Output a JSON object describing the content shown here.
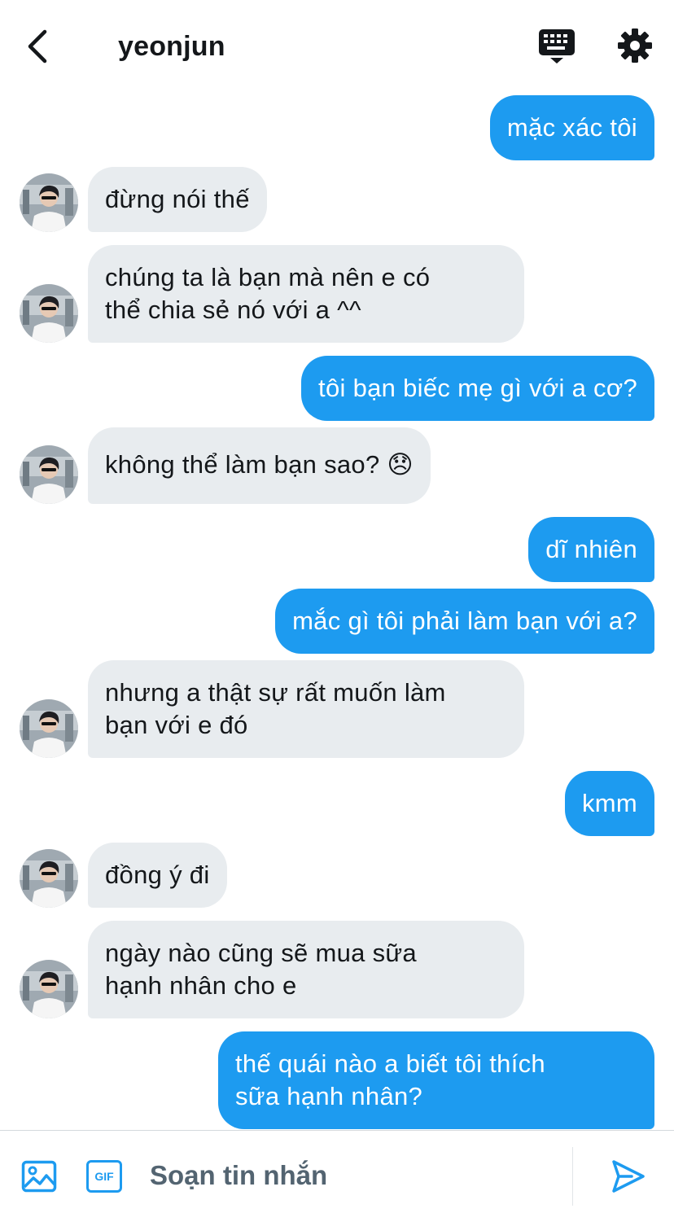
{
  "header": {
    "title": "yeonjun",
    "back_icon": "chevron-left-icon",
    "keyboard_icon": "keyboard-icon",
    "settings_icon": "gear-icon"
  },
  "messages": [
    {
      "side": "out",
      "text": "mặc xác tôi"
    },
    {
      "side": "in",
      "text": "đừng nói thế"
    },
    {
      "side": "in",
      "text": "chúng ta là bạn mà nên e có\nthể chia sẻ nó với a ^^"
    },
    {
      "side": "out",
      "text": "tôi bạn biếc mẹ gì với a cơ?"
    },
    {
      "side": "in",
      "text": "không thể làm bạn sao? 😞"
    },
    {
      "side": "out",
      "text": "dĩ nhiên"
    },
    {
      "side": "out",
      "text": "mắc gì tôi phải làm bạn với a?"
    },
    {
      "side": "in",
      "text": "nhưng a thật sự rất muốn làm\nbạn với e đó"
    },
    {
      "side": "out",
      "text": "kmm"
    },
    {
      "side": "in",
      "text": "đồng ý đi"
    },
    {
      "side": "in",
      "text": "ngày nào cũng sẽ mua sữa\nhạnh nhân cho e"
    },
    {
      "side": "out",
      "text": "thế quái nào a biết tôi thích\nsữa hạnh nhân?"
    }
  ],
  "composer": {
    "placeholder": "Soạn tin nhắn",
    "gif_label": "GIF",
    "media_icon": "image-icon",
    "send_icon": "send-icon"
  },
  "colors": {
    "accent": "#1d9bf0",
    "incoming_bubble": "#e8ecef",
    "text": "#14171a",
    "muted": "#536471"
  }
}
